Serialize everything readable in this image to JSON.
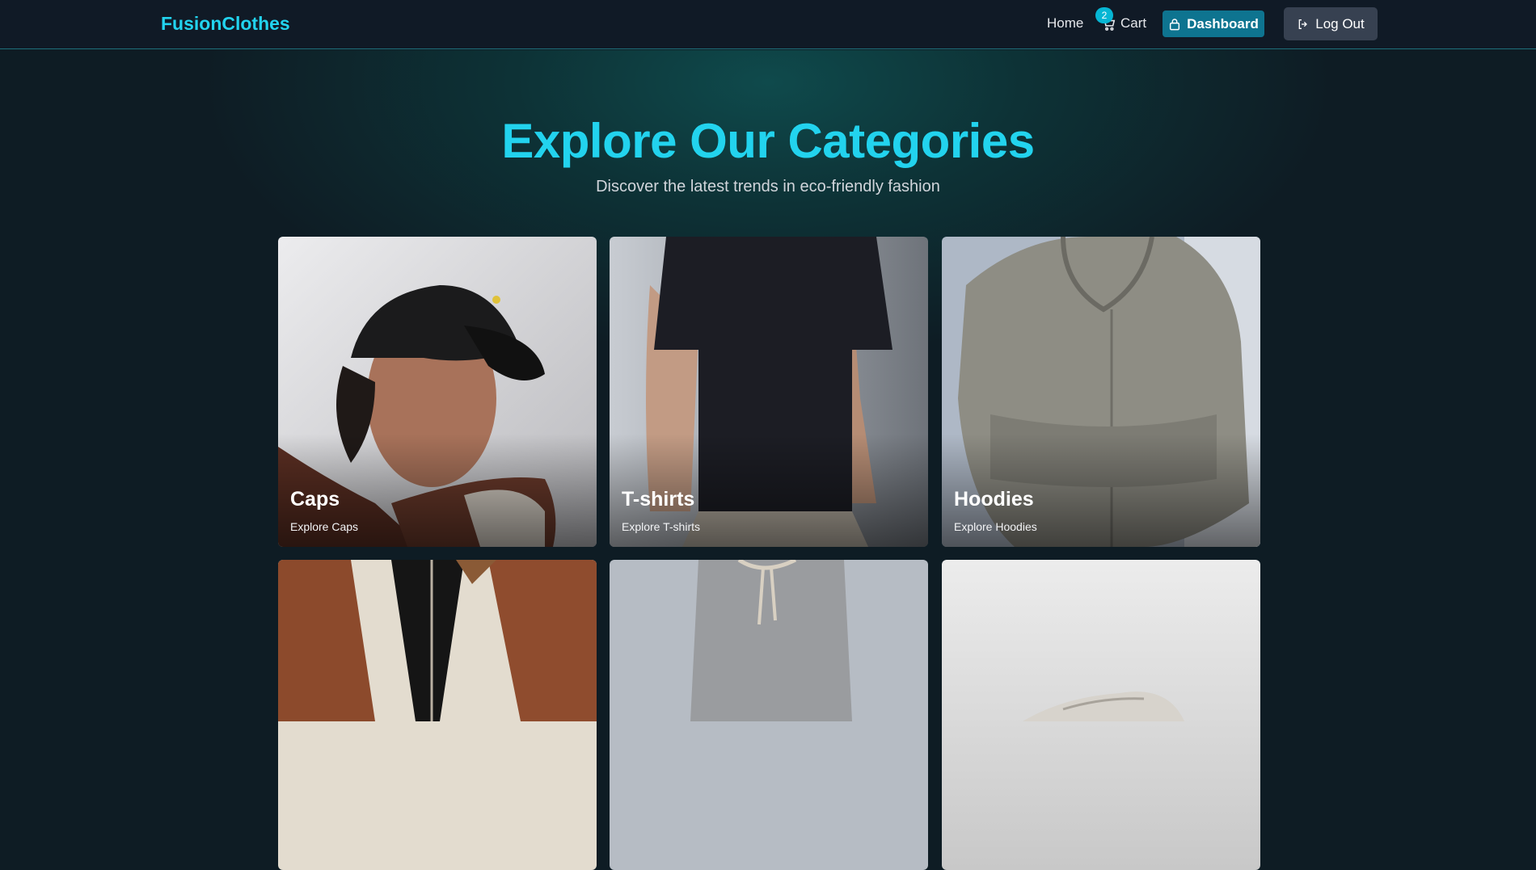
{
  "nav": {
    "logo": "FusionClothes",
    "home": "Home",
    "cart": "Cart",
    "cart_count": "2",
    "dashboard": "Dashboard",
    "logout": "Log Out"
  },
  "hero": {
    "title": "Explore Our Categories",
    "subtitle": "Discover the latest trends in eco-friendly fashion"
  },
  "categories": [
    {
      "title": "Caps",
      "subtitle": "Explore Caps"
    },
    {
      "title": "T-shirts",
      "subtitle": "Explore T-shirts"
    },
    {
      "title": "Hoodies",
      "subtitle": "Explore Hoodies"
    },
    {
      "title": "",
      "subtitle": ""
    },
    {
      "title": "",
      "subtitle": ""
    },
    {
      "title": "",
      "subtitle": ""
    }
  ],
  "colors": {
    "accent": "#22d3ee",
    "navbar_bg": "#101a26",
    "dashboard_bg": "#0e7490",
    "logout_bg": "#374151",
    "page_bg": "#0e1c24"
  },
  "icons": {
    "cart": "cart-icon",
    "dashboard": "lock-icon",
    "logout": "logout-icon"
  }
}
